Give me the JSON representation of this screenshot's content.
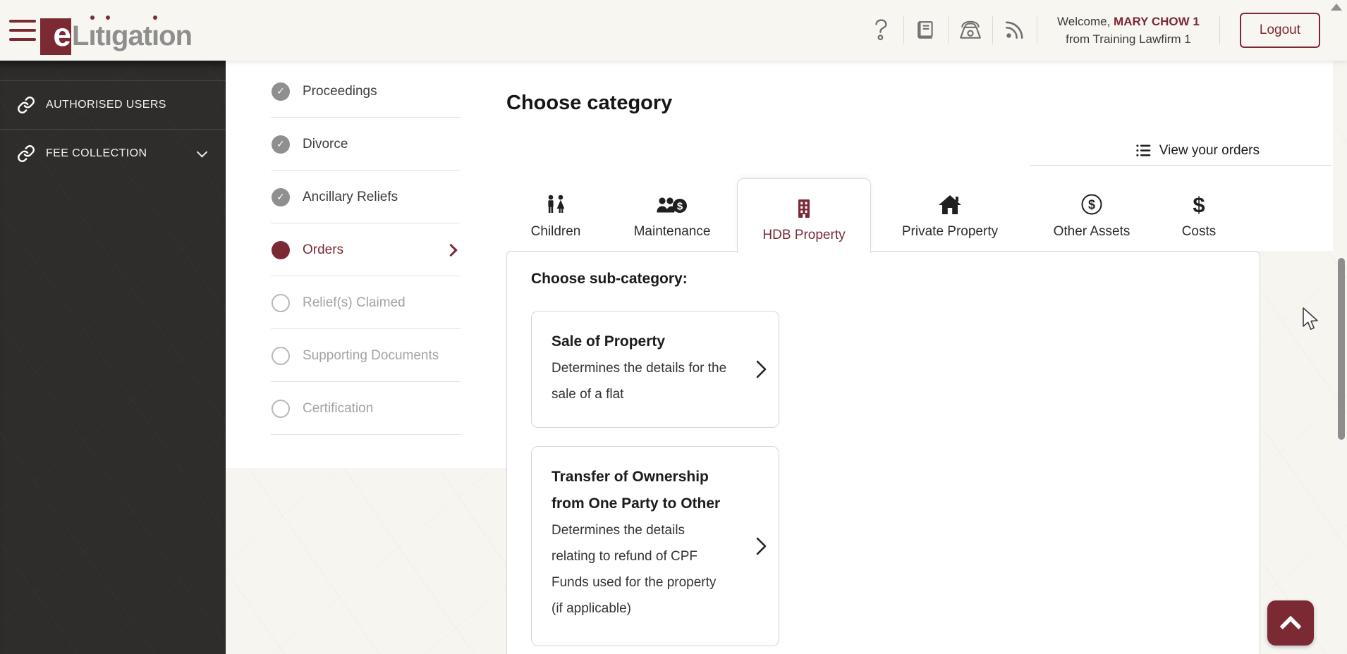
{
  "header": {
    "logo_e": "e",
    "logo_word": "Litigation",
    "welcome_prefix": "Welcome,",
    "user_name": "MARY CHOW 1",
    "firm_line": "from Training Lawfirm 1",
    "logout_label": "Logout"
  },
  "sidebar": {
    "items": [
      {
        "label": "AUTHORISED USERS",
        "icon": "link-icon",
        "expandable": false
      },
      {
        "label": "FEE COLLECTION",
        "icon": "link-icon",
        "expandable": true
      }
    ]
  },
  "steps": {
    "items": [
      {
        "label": "Proceedings",
        "state": "completed"
      },
      {
        "label": "Divorce",
        "state": "completed"
      },
      {
        "label": "Ancillary Reliefs",
        "state": "completed"
      },
      {
        "label": "Orders",
        "state": "current"
      },
      {
        "label": "Relief(s) Claimed",
        "state": "upcoming"
      },
      {
        "label": "Supporting Documents",
        "state": "upcoming"
      },
      {
        "label": "Certification",
        "state": "upcoming"
      }
    ]
  },
  "main": {
    "title": "Choose category",
    "view_orders_label": "View your orders",
    "tabs": [
      {
        "label": "Children",
        "icon": "children-icon",
        "active": false
      },
      {
        "label": "Maintenance",
        "icon": "maintenance-icon",
        "active": false
      },
      {
        "label": "HDB Property",
        "icon": "building-icon",
        "active": true
      },
      {
        "label": "Private Property",
        "icon": "house-icon",
        "active": false
      },
      {
        "label": "Other Assets",
        "icon": "dollar-circle-icon",
        "active": false
      },
      {
        "label": "Costs",
        "icon": "dollar-icon",
        "active": false
      }
    ],
    "subcategory_heading": "Choose sub-category:",
    "cards": [
      {
        "title": "Sale of Property",
        "description": "Determines the details for the\nsale of a flat"
      },
      {
        "title": "Transfer of Ownership\nfrom One Party to Other",
        "description": "Determines the details\nrelating to refund of CPF\nFunds used for the property\n(if applicable)"
      }
    ]
  },
  "colors": {
    "maroon": "#7b2a34",
    "sidebar_bg": "#2e2d2c",
    "completed_step_gray": "#8f8f8f",
    "header_bg": "#f8f6f1"
  }
}
